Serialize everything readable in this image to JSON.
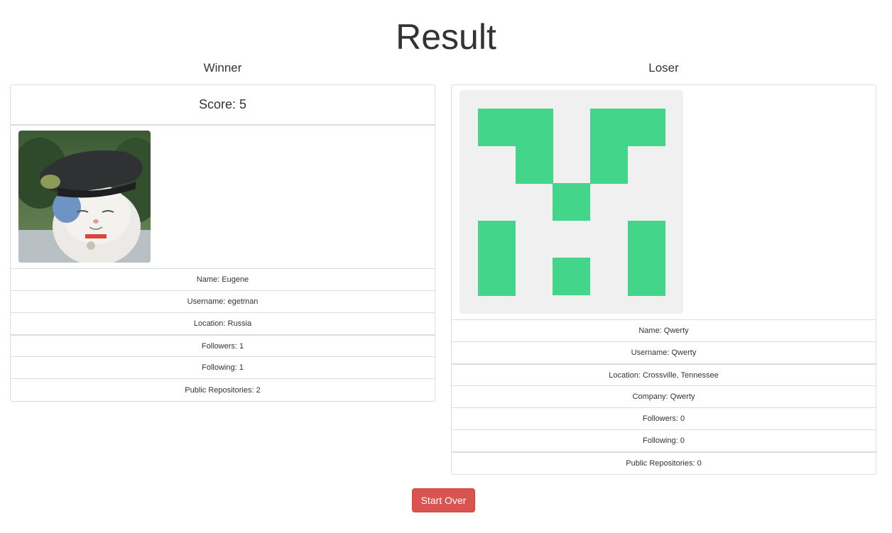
{
  "page": {
    "title": "Result"
  },
  "winner": {
    "heading": "Winner",
    "score": "Score: 5",
    "avatar": "cat-in-cap-photo",
    "name": "Name: Eugene",
    "username": "Username: egetman",
    "location": "Location: Russia",
    "followers": "Followers: 1",
    "following": "Following: 1",
    "public_repos": "Public Repositories: 2"
  },
  "loser": {
    "heading": "Loser",
    "avatar": "identicon",
    "identicon_color": "#43d68a",
    "identicon_bg": "#f0f0f0",
    "name": "Name: Qwerty",
    "username": "Username: Qwerty",
    "location": "Location: Crossville, Tennessee",
    "company": "Company: Qwerty",
    "followers": "Followers: 0",
    "following": "Following: 0",
    "public_repos": "Public Repositories: 0"
  },
  "actions": {
    "start_over_label": "Start Over",
    "start_over_color": "#d9534f"
  }
}
